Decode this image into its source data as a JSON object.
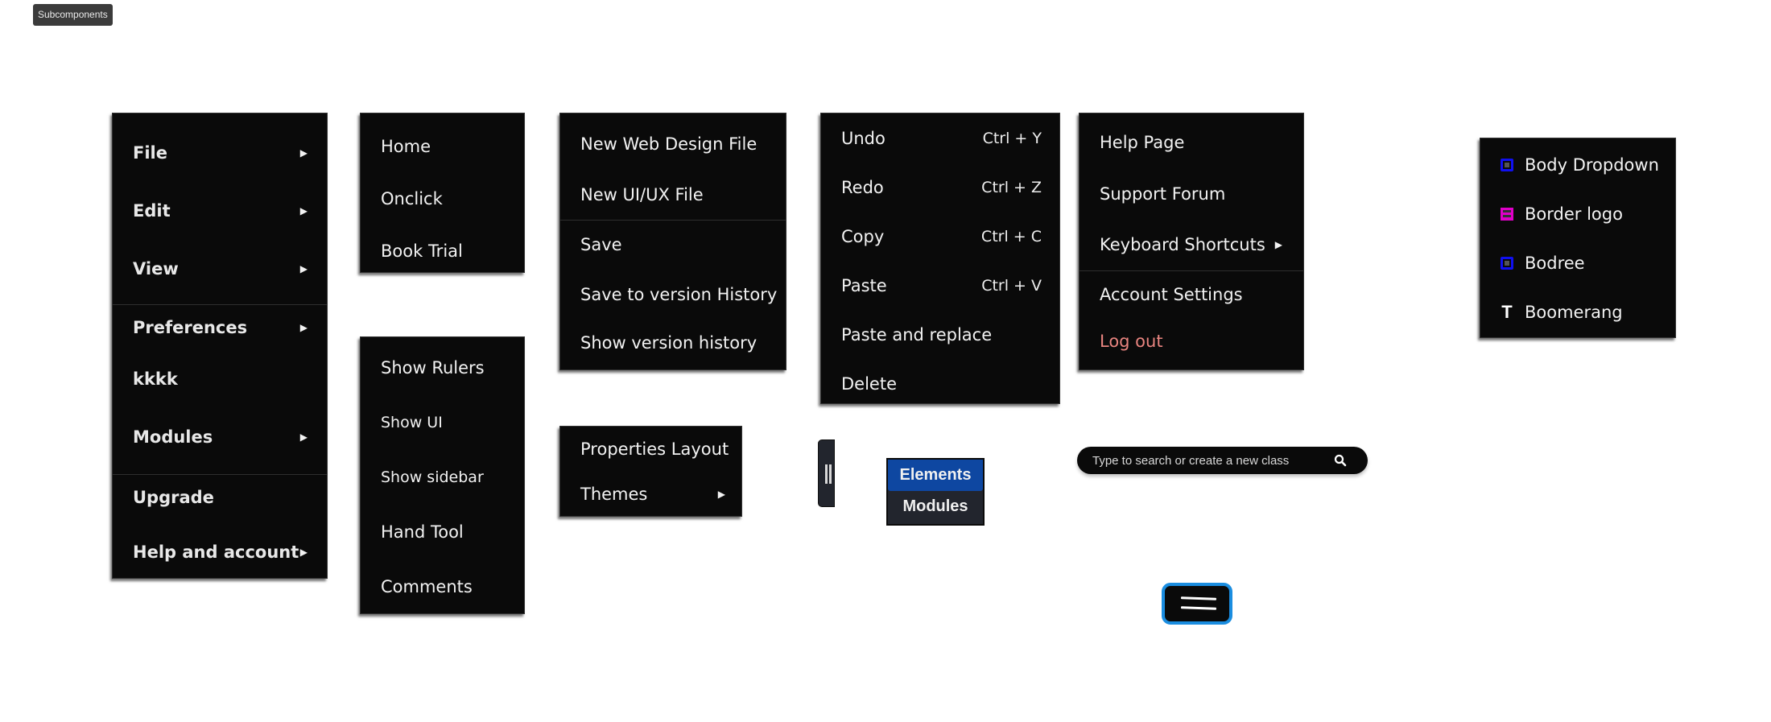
{
  "subcomponents_tag": "Subcomponents",
  "main_menu": {
    "items": [
      {
        "label": "File",
        "has_submenu": true
      },
      {
        "label": "Edit",
        "has_submenu": true
      },
      {
        "label": "View",
        "has_submenu": true
      },
      {
        "label": "Preferences",
        "has_submenu": true
      },
      {
        "label": "kkkk",
        "has_submenu": false
      },
      {
        "label": "Modules",
        "has_submenu": true
      },
      {
        "label": "Upgrade",
        "has_submenu": false
      },
      {
        "label": "Help and account",
        "has_submenu": true
      }
    ],
    "arrow_glyph": "▶"
  },
  "nav_menu": {
    "items": [
      "Home",
      "Onclick",
      "Book Trial"
    ]
  },
  "view_menu": {
    "items": [
      "Show Rulers",
      "Show UI",
      "Show sidebar",
      "Hand Tool",
      "Comments"
    ]
  },
  "file_menu": {
    "items": [
      "New Web Design File",
      "New UI/UX File",
      "Save",
      "Save to version History",
      "Show version history"
    ]
  },
  "preferences_menu": {
    "items": [
      {
        "label": "Properties Layout",
        "has_submenu": false
      },
      {
        "label": "Themes",
        "has_submenu": true
      }
    ]
  },
  "edit_menu": {
    "items": [
      {
        "label": "Undo",
        "shortcut": "Ctrl + Y"
      },
      {
        "label": "Redo",
        "shortcut": "Ctrl + Z"
      },
      {
        "label": "Copy",
        "shortcut": "Ctrl + C"
      },
      {
        "label": "Paste",
        "shortcut": "Ctrl + V"
      },
      {
        "label": "Paste and replace",
        "shortcut": ""
      },
      {
        "label": "Delete",
        "shortcut": ""
      }
    ]
  },
  "help_menu": {
    "items": [
      {
        "label": "Help Page",
        "has_submenu": false
      },
      {
        "label": "Support Forum",
        "has_submenu": false
      },
      {
        "label": "Keyboard Shortcuts",
        "has_submenu": true
      },
      {
        "label": "Account Settings",
        "has_submenu": false
      },
      {
        "label": "Log out",
        "has_submenu": false,
        "color": "#e8847f"
      }
    ]
  },
  "components_menu": {
    "items": [
      {
        "label": "Body Dropdown",
        "icon": "div-block-icon"
      },
      {
        "label": "Border logo",
        "icon": "section-icon"
      },
      {
        "label": "Bodree",
        "icon": "div-block-icon"
      },
      {
        "label": "Boomerang",
        "icon": "text-icon"
      }
    ],
    "icon_colors": {
      "div_block": "#1010f0",
      "section": "#e000c8",
      "text": "#ffffff"
    }
  },
  "panel_tabs": {
    "tabs": [
      "Elements",
      "Modules"
    ],
    "active": "Elements",
    "active_color": "#0e47a1"
  },
  "class_search": {
    "placeholder": "Type to search or create a new class",
    "value": ""
  },
  "hamburger": {
    "border_color": "#1a8de0"
  }
}
